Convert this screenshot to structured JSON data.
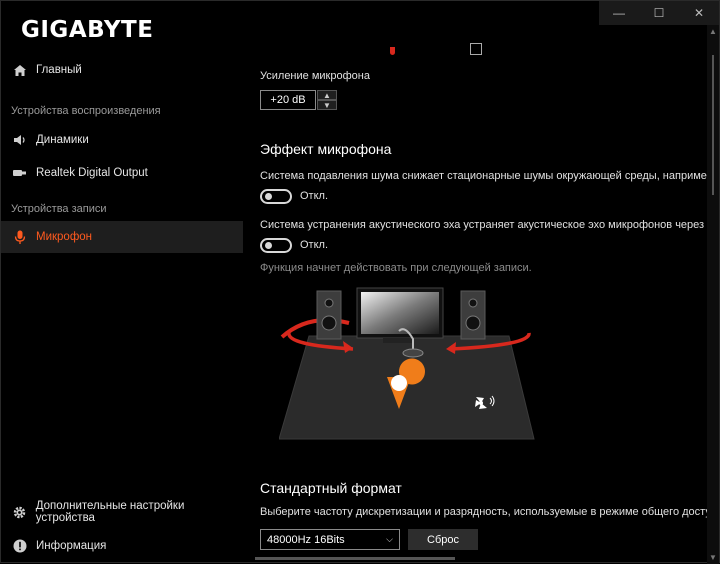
{
  "app": {
    "logo": "GIGABYTE"
  },
  "window_controls": {
    "minimize": "—",
    "maximize": "☐",
    "close": "✕"
  },
  "sidebar": {
    "home": "Главный",
    "playback_header": "Устройства воспроизведения",
    "speakers": "Динамики",
    "realtek": "Realtek Digital Output",
    "recording_header": "Устройства записи",
    "microphone": "Микрофон",
    "advanced": "Дополнительные настройки устройства",
    "info": "Информация"
  },
  "main": {
    "gain_label": "Усиление микрофона",
    "gain_value": "+20 dB",
    "effect_title": "Эффект микрофона",
    "noise_desc": "Система подавления шума снижает стационарные шумы окружающей среды, например, шу",
    "noise_state": "Откл.",
    "echo_desc": "Система устранения акустического эха устраняет акустическое эхо микрофонов через выход",
    "echo_state": "Откл.",
    "note": "Функция начнет действовать при следующей записи.",
    "format_title": "Стандартный формат",
    "format_desc": "Выберите частоту дискретизации и разрядность, используемые в режиме общего доступа.",
    "format_value": "48000Hz 16Bits",
    "reset_label": "Сброс"
  },
  "colors": {
    "accent": "#ff5a1f",
    "arrow_red": "#d8281d",
    "pin_orange": "#f07d1a"
  }
}
